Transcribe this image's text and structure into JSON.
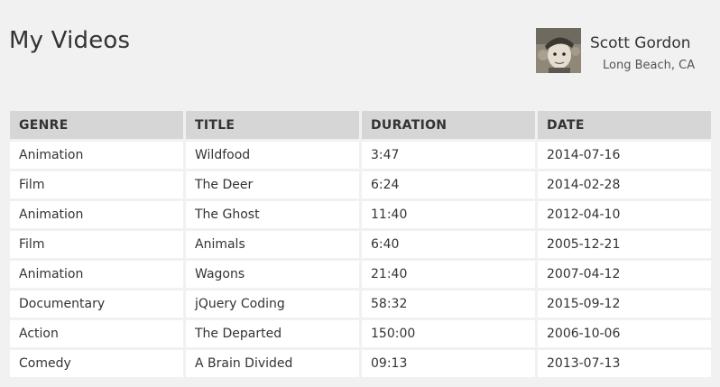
{
  "header": {
    "title": "My Videos"
  },
  "profile": {
    "name": "Scott Gordon",
    "location": "Long Beach, CA",
    "avatar_icon": "user-avatar-photo"
  },
  "table": {
    "columns": [
      "GENRE",
      "TITLE",
      "DURATION",
      "DATE"
    ],
    "rows": [
      [
        "Animation",
        "Wildfood",
        "3:47",
        "2014-07-16"
      ],
      [
        "Film",
        "The Deer",
        "6:24",
        "2014-02-28"
      ],
      [
        "Animation",
        "The Ghost",
        "11:40",
        "2012-04-10"
      ],
      [
        "Film",
        "Animals",
        "6:40",
        "2005-12-21"
      ],
      [
        "Animation",
        "Wagons",
        "21:40",
        "2007-04-12"
      ],
      [
        "Documentary",
        "jQuery Coding",
        "58:32",
        "2015-09-12"
      ],
      [
        "Action",
        "The Departed",
        "150:00",
        "2006-10-06"
      ],
      [
        "Comedy",
        "A Brain Divided",
        "09:13",
        "2013-07-13"
      ]
    ]
  },
  "colors": {
    "background": "#f1f1f1",
    "header_cell": "#d6d6d6",
    "body_cell": "#ffffff",
    "text": "#333333"
  }
}
